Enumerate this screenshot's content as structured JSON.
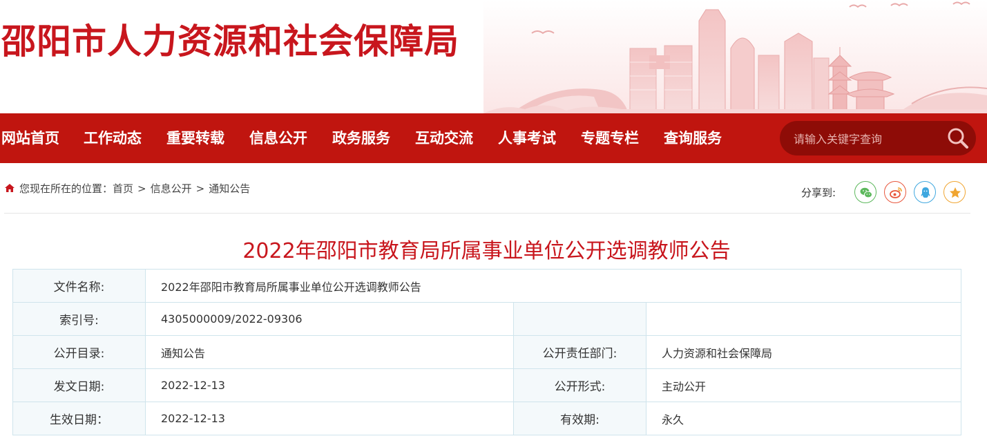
{
  "header": {
    "site_title": "邵阳市人力资源和社会保障局"
  },
  "nav": {
    "items": [
      "网站首页",
      "工作动态",
      "重要转载",
      "信息公开",
      "政务服务",
      "互动交流",
      "人事考试",
      "专题专栏",
      "查询服务"
    ]
  },
  "search": {
    "placeholder": "请输入关键字查询",
    "icon": "search-icon"
  },
  "breadcrumb": {
    "prefix": "您现在所在的位置：",
    "items": [
      "首页",
      "信息公开",
      "通知公告"
    ],
    "separator": ">"
  },
  "share": {
    "label": "分享到:",
    "targets": [
      {
        "name": "wechat",
        "color": "#5cb85c"
      },
      {
        "name": "weibo",
        "color": "#e8563c"
      },
      {
        "name": "qq",
        "color": "#3ea7df"
      },
      {
        "name": "favorite",
        "color": "#f0a531"
      }
    ]
  },
  "article": {
    "title": "2022年邵阳市教育局所属事业单位公开选调教师公告",
    "meta": {
      "file_name_label": "文件名称:",
      "file_name": "2022年邵阳市教育局所属事业单位公开选调教师公告",
      "index_label": "索引号:",
      "index": "4305000009/2022-09306",
      "catalog_label": "公开目录:",
      "catalog": "通知公告",
      "dept_label": "公开责任部门:",
      "dept": "人力资源和社会保障局",
      "issue_date_label": "发文日期:",
      "issue_date": "2022-12-13",
      "form_label": "公开形式:",
      "form": "主动公开",
      "effective_date_label": "生效日期：",
      "effective_date": "2022-12-13",
      "validity_label": "有效期:",
      "validity": "永久"
    }
  },
  "colors": {
    "brand_red": "#c8161d",
    "nav_red": "#c0150f",
    "search_bg": "#8e0c07",
    "table_border": "#cfe4ec",
    "label_bg": "#f4f9fb"
  }
}
